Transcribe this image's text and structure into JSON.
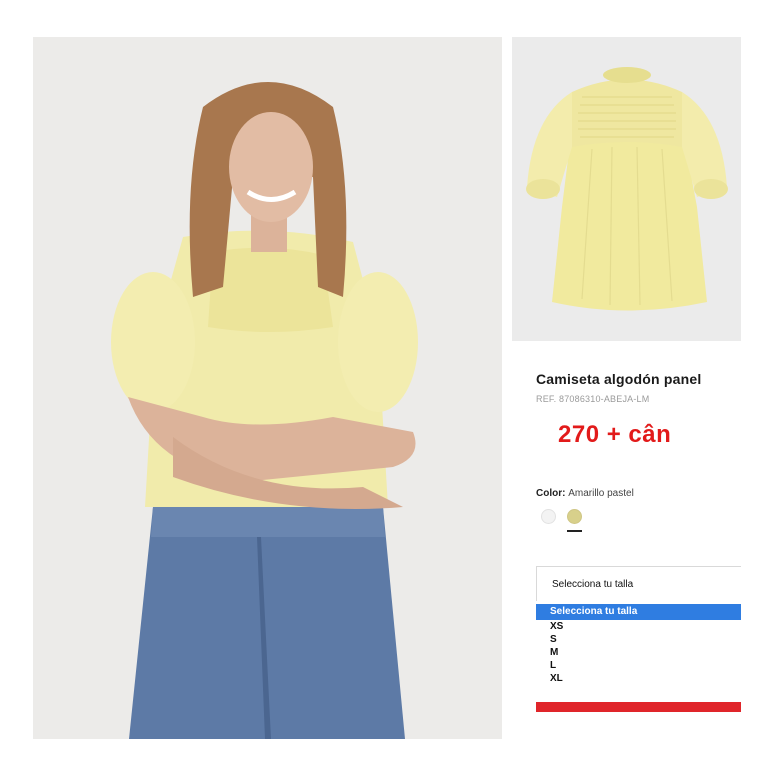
{
  "product": {
    "title": "Camiseta algodón panel",
    "ref": "REF. 87086310-ABEJA-LM",
    "price": "270 + cân"
  },
  "color": {
    "label": "Color:",
    "value": "Amarillo pastel",
    "swatches": [
      "white",
      "yellow"
    ],
    "selected": "yellow"
  },
  "size_select": {
    "label": "Selecciona tu talla",
    "options": [
      "Selecciona tu talla",
      "XS",
      "S",
      "M",
      "L",
      "XL"
    ],
    "selected": "Selecciona tu talla"
  },
  "colors": {
    "price": "#e21a1a",
    "selected_option_bg": "#2f7de1",
    "bottom_bar": "#e0252a",
    "garment": "#f2ecac"
  }
}
